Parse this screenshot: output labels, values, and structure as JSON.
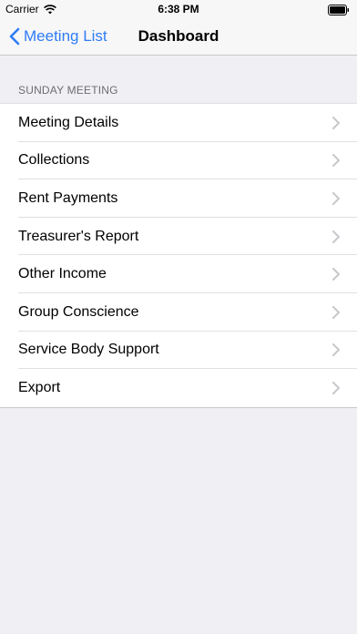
{
  "status_bar": {
    "carrier": "Carrier",
    "time": "6:38 PM",
    "wifi_icon": "wifi-icon",
    "battery_icon": "battery-icon"
  },
  "nav": {
    "back_label": "Meeting List",
    "title": "Dashboard",
    "accent_color": "#2f7cf6"
  },
  "section": {
    "header": "SUNDAY MEETING"
  },
  "items": [
    {
      "label": "Meeting Details"
    },
    {
      "label": "Collections"
    },
    {
      "label": "Rent Payments"
    },
    {
      "label": "Treasurer's Report"
    },
    {
      "label": "Other Income"
    },
    {
      "label": "Group Conscience"
    },
    {
      "label": "Service Body Support"
    },
    {
      "label": "Export"
    }
  ]
}
